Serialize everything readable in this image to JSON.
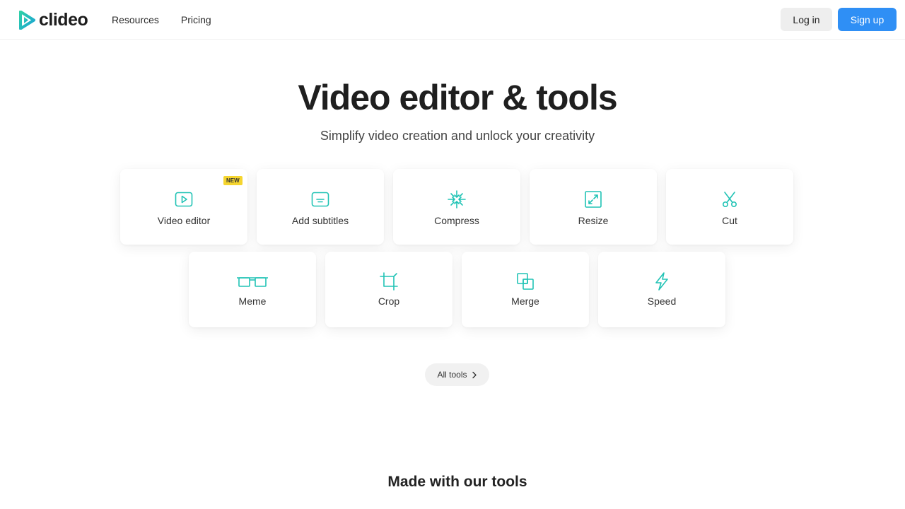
{
  "brand": {
    "name": "clideo",
    "accent": "#21c3b5",
    "primary": "#2f8ff5"
  },
  "nav": {
    "items": [
      "Resources",
      "Pricing"
    ]
  },
  "auth": {
    "login_label": "Log in",
    "signup_label": "Sign up"
  },
  "hero": {
    "title": "Video editor & tools",
    "subtitle": "Simplify video creation and unlock your creativity"
  },
  "tools": [
    {
      "label": "Video editor",
      "icon": "play-icon",
      "badge": "NEW"
    },
    {
      "label": "Add subtitles",
      "icon": "subtitles-icon"
    },
    {
      "label": "Compress",
      "icon": "compress-icon"
    },
    {
      "label": "Resize",
      "icon": "resize-icon"
    },
    {
      "label": "Cut",
      "icon": "scissors-icon"
    },
    {
      "label": "Meme",
      "icon": "meme-icon"
    },
    {
      "label": "Crop",
      "icon": "crop-icon"
    },
    {
      "label": "Merge",
      "icon": "merge-icon"
    },
    {
      "label": "Speed",
      "icon": "lightning-icon"
    }
  ],
  "all_tools_label": "All tools",
  "section": {
    "made_title": "Made with our tools"
  }
}
